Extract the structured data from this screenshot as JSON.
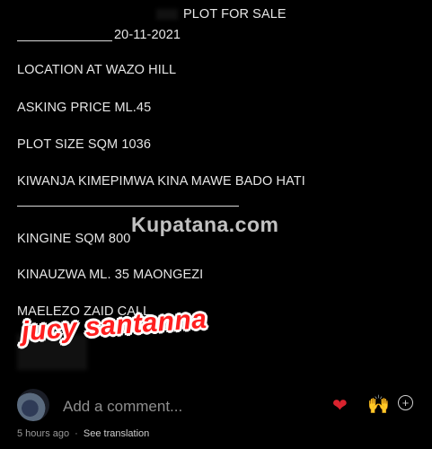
{
  "post": {
    "title": "PLOT FOR SALE",
    "date": "20-11-2021",
    "location": "LOCATION AT WAZO HILL",
    "price": "ASKING PRICE ML.45",
    "size": "PLOT SIZE SQM 1036",
    "note": "KIWANJA KIMEPIMWA KINA MAWE BADO HATI",
    "other_plot": "KINGINE SQM 800",
    "other_price": "KINAUZWA ML. 35 MAONGEZI",
    "contact": "MAELEZO ZAID CALL"
  },
  "overlays": {
    "watermark": "Kupatana.com",
    "sticker": "jucy santanna"
  },
  "composer": {
    "placeholder": "Add a comment...",
    "heart_icon": "heart-icon",
    "hands_icon": "raised-hands-icon",
    "add_icon": "plus-circle-icon"
  },
  "meta": {
    "time_ago": "5 hours ago",
    "translate": "See translation"
  },
  "colors": {
    "background": "#000000",
    "text": "#e6e6e6",
    "sticker": "#ff1f1f",
    "heart": "#d9232e"
  }
}
